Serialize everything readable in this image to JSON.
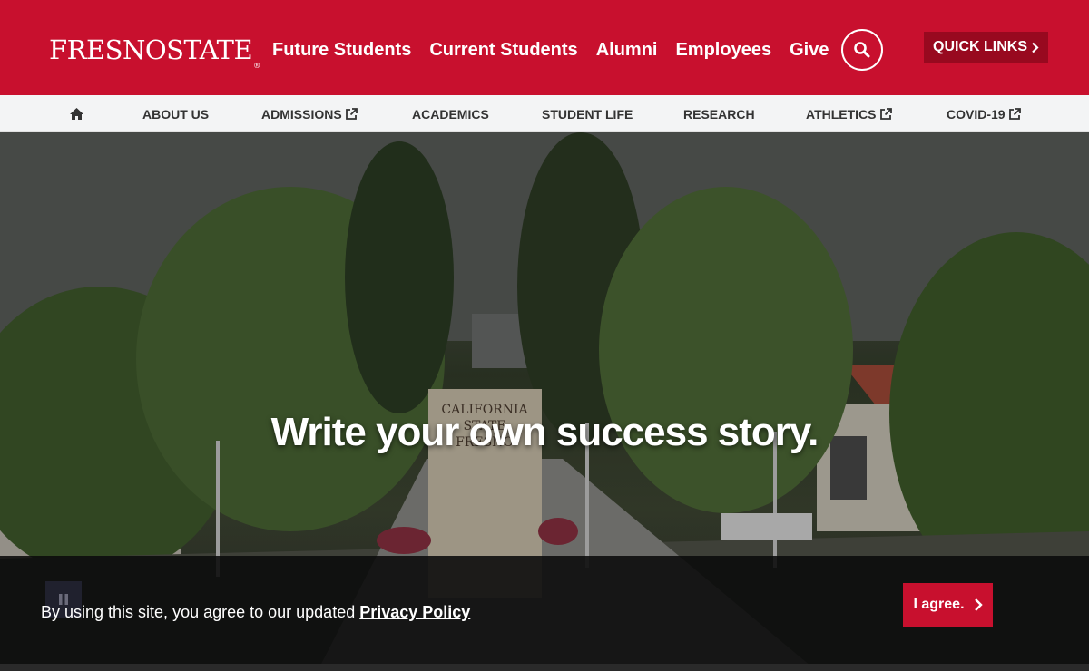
{
  "header": {
    "logo_text": "FRESNOSTATE",
    "logo_reg": "®",
    "nav": [
      {
        "label": "Future Students"
      },
      {
        "label": "Current Students"
      },
      {
        "label": "Alumni"
      },
      {
        "label": "Employees"
      },
      {
        "label": "Give"
      }
    ],
    "search_icon": "search-icon",
    "quick_links_label": "QUICK LINKS"
  },
  "subnav": {
    "home_icon": "home-icon",
    "items": [
      {
        "label": "ABOUT US",
        "external": false
      },
      {
        "label": "ADMISSIONS",
        "external": true
      },
      {
        "label": "ACADEMICS",
        "external": false
      },
      {
        "label": "STUDENT LIFE",
        "external": false
      },
      {
        "label": "RESEARCH",
        "external": false
      },
      {
        "label": "ATHLETICS",
        "external": true
      },
      {
        "label": "COVID-19",
        "external": true
      }
    ]
  },
  "hero": {
    "heading": "Write your own success story.",
    "sign_text": "CALIFORNIA STATE FRESNO"
  },
  "cookie_banner": {
    "text": "By using this site, you agree to our updated ",
    "link": "Privacy Policy",
    "agree_label": "I agree."
  },
  "colors": {
    "brand_red": "#c8102e",
    "dark_red": "#98091f"
  }
}
